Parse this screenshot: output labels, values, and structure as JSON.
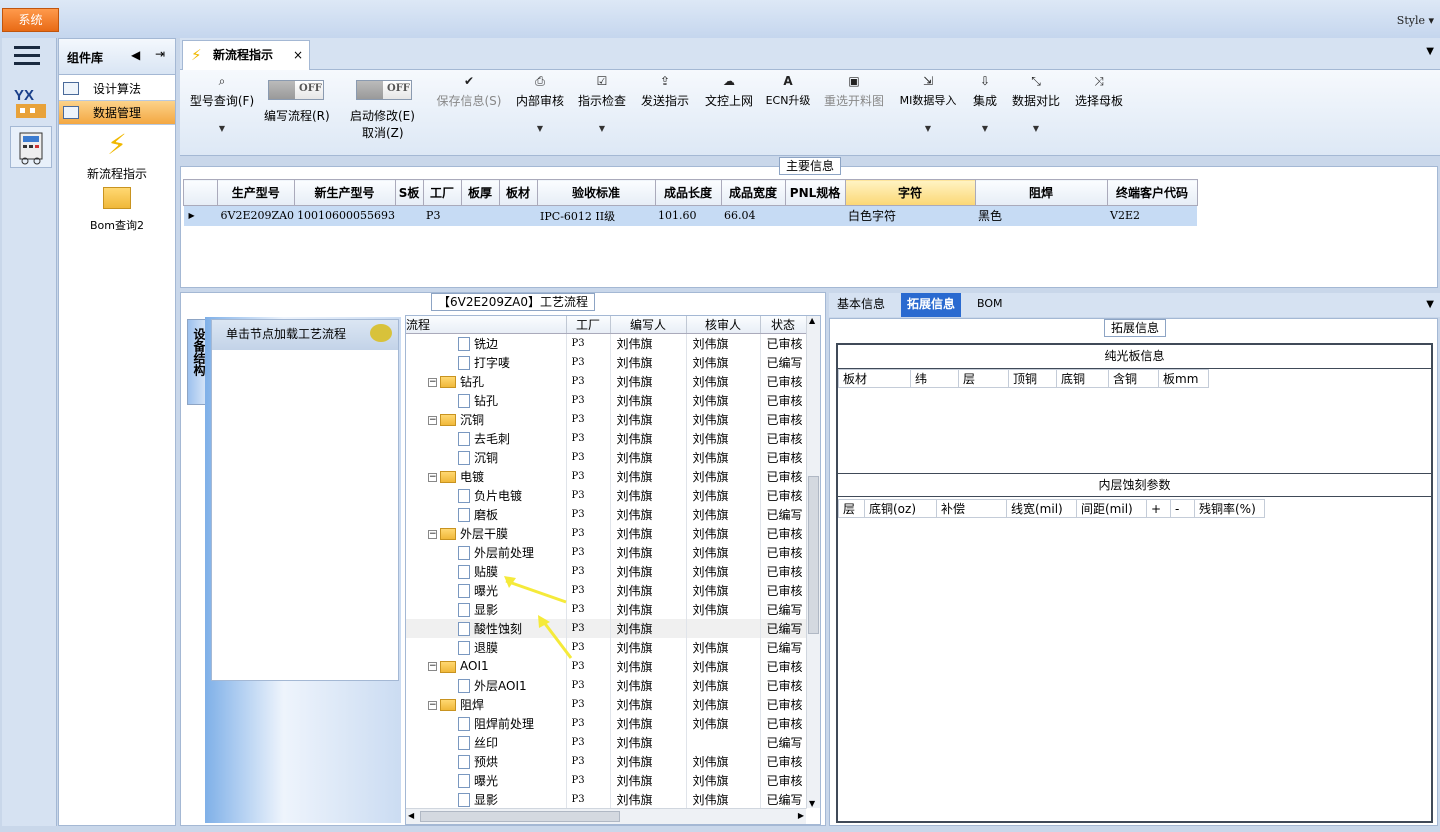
{
  "app": {
    "system_label": "系统",
    "style_label": "Style ▾"
  },
  "component_lib": {
    "title": "组件库",
    "items": [
      {
        "label": "设计算法"
      },
      {
        "label": "数据管理"
      }
    ],
    "tools": [
      {
        "label": "新流程指示"
      },
      {
        "label": "Bom查询2"
      }
    ]
  },
  "tab": {
    "label": "新流程指示",
    "close": "×"
  },
  "ribbon": {
    "model_query": "型号查询(F)",
    "edit_flow": "编写流程(R)",
    "enable_edit": "启动修改(E)",
    "cancel": "取消(Z)",
    "toggle_off": "OFF",
    "buttons": [
      {
        "label": "保存信息(S)",
        "icon": "check-icon"
      },
      {
        "label": "内部审核",
        "icon": "printer-icon"
      },
      {
        "label": "指示检查",
        "icon": "check-square-icon"
      },
      {
        "label": "发送指示",
        "icon": "upload-icon"
      },
      {
        "label": "文控上网",
        "icon": "cloud-upload-icon"
      },
      {
        "label": "ECN升级",
        "icon": "font-icon"
      },
      {
        "label": "重选开料图",
        "icon": "image-icon"
      },
      {
        "label": "MI数据导入",
        "icon": "sign-in-icon"
      },
      {
        "label": "集成",
        "icon": "download-icon"
      },
      {
        "label": "数据对比",
        "icon": "compress-icon"
      },
      {
        "label": "选择母板",
        "icon": "random-icon"
      }
    ]
  },
  "main_info": {
    "title": "主要信息",
    "columns": [
      "生产型号",
      "新生产型号",
      "S板",
      "工厂",
      "板厚",
      "板材",
      "验收标准",
      "成品长度",
      "成品宽度",
      "PNL规格",
      "字符",
      "阻焊",
      "终端客户代码"
    ],
    "rows": [
      [
        "6V2E209ZA0",
        "10010600055693",
        "",
        "P3",
        "",
        "",
        "IPC-6012 II级",
        "101.60",
        "66.04",
        "",
        "白色字符",
        "黑色",
        "V2E2"
      ]
    ]
  },
  "process": {
    "title": "【6V2E209ZA0】工艺流程",
    "side_tab": "设备结构",
    "hint": "单击节点加载工艺流程",
    "columns": [
      "流程",
      "工厂",
      "编写人",
      "核审人",
      "状态"
    ],
    "rows": [
      {
        "name": "铣边",
        "type": "file",
        "factory": "P3",
        "writer": "刘伟旗",
        "reviewer": "刘伟旗",
        "status": "已审核"
      },
      {
        "name": "打字唛",
        "type": "file",
        "factory": "P3",
        "writer": "刘伟旗",
        "reviewer": "刘伟旗",
        "status": "已编写"
      },
      {
        "name": "钻孔",
        "type": "folder",
        "factory": "P3",
        "writer": "刘伟旗",
        "reviewer": "刘伟旗",
        "status": "已审核"
      },
      {
        "name": "钻孔",
        "type": "file",
        "factory": "P3",
        "writer": "刘伟旗",
        "reviewer": "刘伟旗",
        "status": "已审核"
      },
      {
        "name": "沉铜",
        "type": "folder",
        "factory": "P3",
        "writer": "刘伟旗",
        "reviewer": "刘伟旗",
        "status": "已审核"
      },
      {
        "name": "去毛刺",
        "type": "file",
        "factory": "P3",
        "writer": "刘伟旗",
        "reviewer": "刘伟旗",
        "status": "已审核"
      },
      {
        "name": "沉铜",
        "type": "file",
        "factory": "P3",
        "writer": "刘伟旗",
        "reviewer": "刘伟旗",
        "status": "已审核"
      },
      {
        "name": "电镀",
        "type": "folder",
        "factory": "P3",
        "writer": "刘伟旗",
        "reviewer": "刘伟旗",
        "status": "已审核"
      },
      {
        "name": "负片电镀",
        "type": "file",
        "factory": "P3",
        "writer": "刘伟旗",
        "reviewer": "刘伟旗",
        "status": "已审核"
      },
      {
        "name": "磨板",
        "type": "file",
        "factory": "P3",
        "writer": "刘伟旗",
        "reviewer": "刘伟旗",
        "status": "已编写"
      },
      {
        "name": "外层干膜",
        "type": "folder",
        "factory": "P3",
        "writer": "刘伟旗",
        "reviewer": "刘伟旗",
        "status": "已审核"
      },
      {
        "name": "外层前处理",
        "type": "file",
        "factory": "P3",
        "writer": "刘伟旗",
        "reviewer": "刘伟旗",
        "status": "已审核"
      },
      {
        "name": "贴膜",
        "type": "file",
        "factory": "P3",
        "writer": "刘伟旗",
        "reviewer": "刘伟旗",
        "status": "已审核"
      },
      {
        "name": "曝光",
        "type": "file",
        "factory": "P3",
        "writer": "刘伟旗",
        "reviewer": "刘伟旗",
        "status": "已审核"
      },
      {
        "name": "显影",
        "type": "file",
        "factory": "P3",
        "writer": "刘伟旗",
        "reviewer": "刘伟旗",
        "status": "已编写"
      },
      {
        "name": "酸性蚀刻",
        "type": "file",
        "factory": "P3",
        "writer": "刘伟旗",
        "reviewer": "",
        "status": "已编写"
      },
      {
        "name": "退膜",
        "type": "file",
        "factory": "P3",
        "writer": "刘伟旗",
        "reviewer": "刘伟旗",
        "status": "已编写"
      },
      {
        "name": "AOI1",
        "type": "folder",
        "factory": "P3",
        "writer": "刘伟旗",
        "reviewer": "刘伟旗",
        "status": "已审核"
      },
      {
        "name": "外层AOI1",
        "type": "file",
        "factory": "P3",
        "writer": "刘伟旗",
        "reviewer": "刘伟旗",
        "status": "已审核"
      },
      {
        "name": "阻焊",
        "type": "folder",
        "factory": "P3",
        "writer": "刘伟旗",
        "reviewer": "刘伟旗",
        "status": "已审核"
      },
      {
        "name": "阻焊前处理",
        "type": "file",
        "factory": "P3",
        "writer": "刘伟旗",
        "reviewer": "刘伟旗",
        "status": "已审核"
      },
      {
        "name": "丝印",
        "type": "file",
        "factory": "P3",
        "writer": "刘伟旗",
        "reviewer": "",
        "status": "已编写"
      },
      {
        "name": "预烘",
        "type": "file",
        "factory": "P3",
        "writer": "刘伟旗",
        "reviewer": "刘伟旗",
        "status": "已审核"
      },
      {
        "name": "曝光",
        "type": "file",
        "factory": "P3",
        "writer": "刘伟旗",
        "reviewer": "刘伟旗",
        "status": "已审核"
      },
      {
        "name": "显影",
        "type": "file",
        "factory": "P3",
        "writer": "刘伟旗",
        "reviewer": "刘伟旗",
        "status": "已编写"
      }
    ]
  },
  "right": {
    "tabs": [
      "基本信息",
      "拓展信息",
      "BOM"
    ],
    "ext_title": "拓展信息",
    "board_title": "纯光板信息",
    "board_cols": [
      "板材",
      "纬",
      "层",
      "顶铜",
      "底铜",
      "含铜",
      "板mm"
    ],
    "etch_title": "内层蚀刻参数",
    "etch_cols": [
      "层",
      "底铜(oz)",
      "补偿",
      "线宽(mil)",
      "间距(mil)",
      "+",
      "-",
      "残铜率(%)"
    ]
  }
}
